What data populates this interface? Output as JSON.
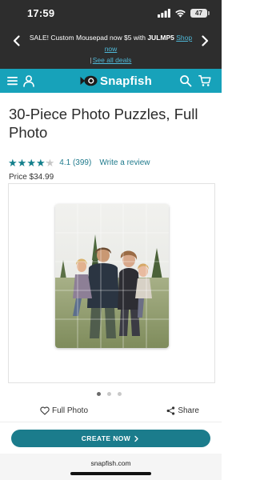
{
  "status_bar": {
    "time": "17:59",
    "battery": "47",
    "icons": [
      "signal-icon",
      "wifi-icon",
      "battery-icon"
    ]
  },
  "promo": {
    "text": "SALE! Custom Mousepad now $5 with",
    "code": "JULMP5",
    "shop_now": "Shop now",
    "separator": "|",
    "see_all": "See all deals",
    "link_color": "#4fb9d9"
  },
  "header": {
    "logo_text": "Snapfish",
    "background_color": "#17a2ba",
    "icons": [
      "menu-icon",
      "account-icon",
      "search-icon",
      "cart-icon"
    ]
  },
  "product": {
    "title": "30-Piece Photo Puzzles, Full Photo",
    "rating": 4.1,
    "rating_text": "4.1 (399)",
    "write_review": "Write a review",
    "price": "Price $34.99",
    "star_color": "#137f8c"
  },
  "carousel": {
    "active_index": 1,
    "count": 3
  },
  "actions": {
    "favorite_label": "Full Photo",
    "share_label": "Share"
  },
  "cta": {
    "label": "CREATE NOW",
    "color": "#1b7c8c"
  },
  "browser": {
    "url": "snapfish.com"
  }
}
